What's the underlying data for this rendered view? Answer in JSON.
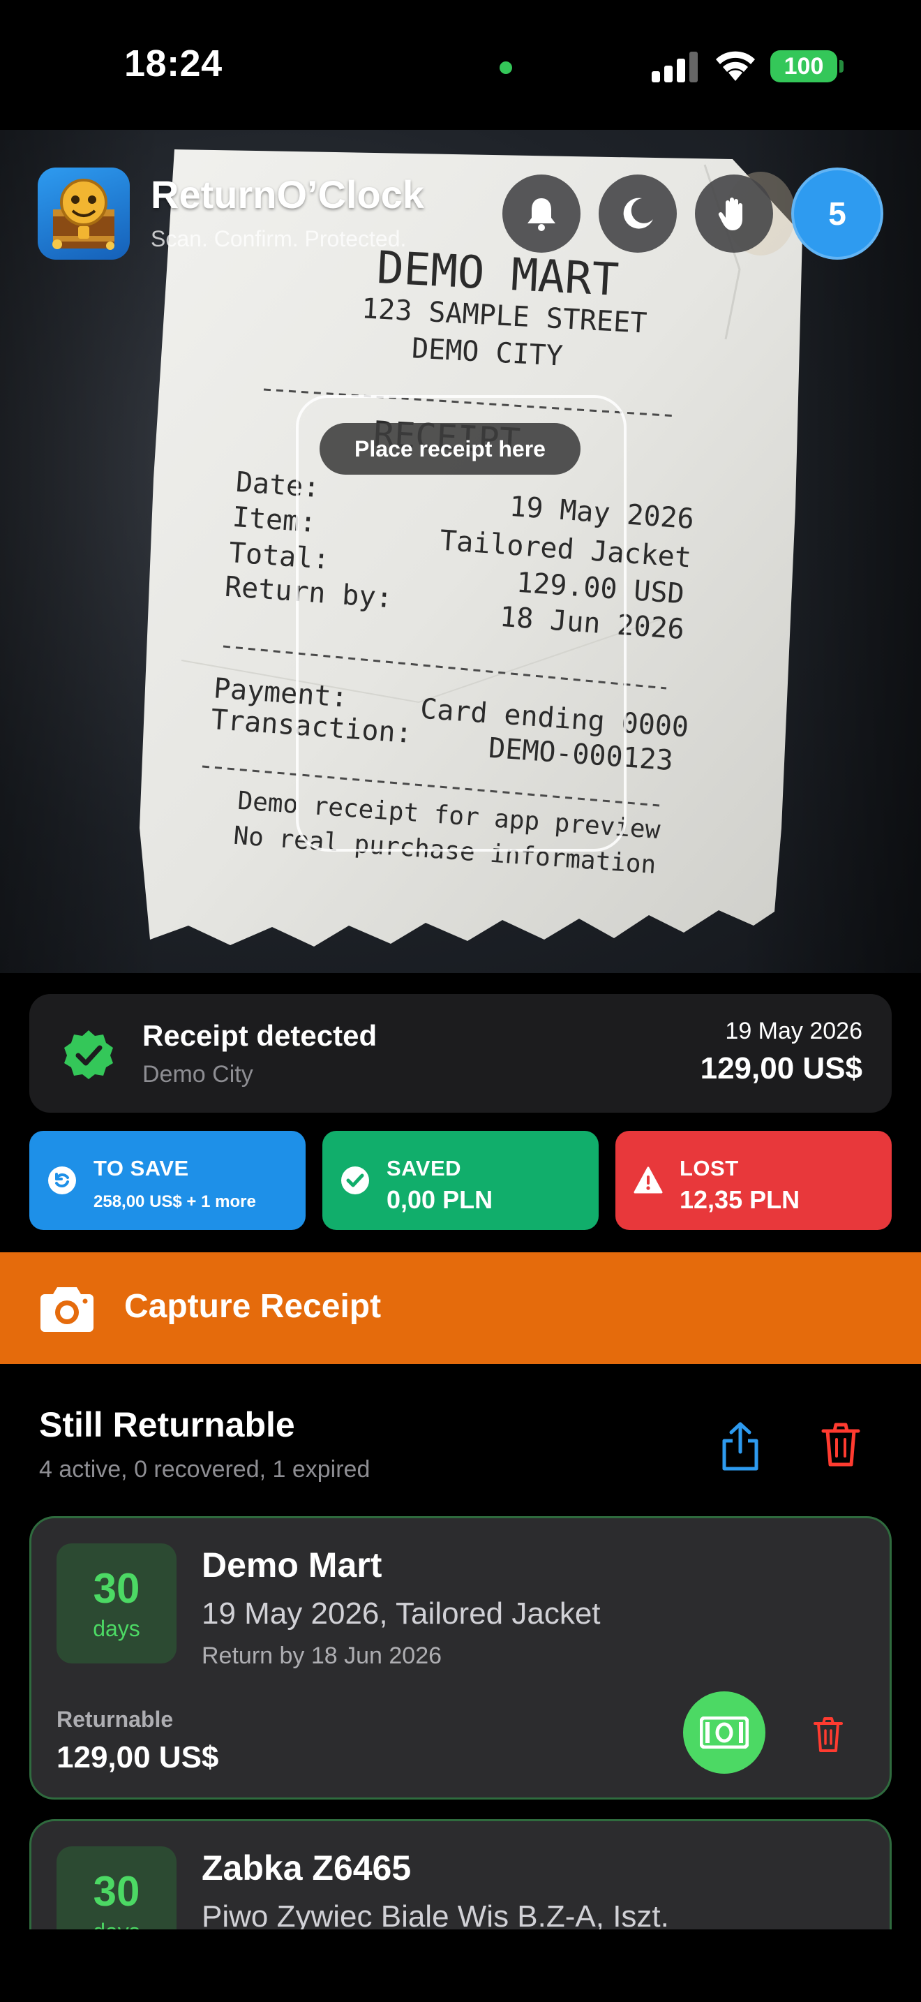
{
  "status_bar": {
    "time": "18:24",
    "battery": "100"
  },
  "camera": {
    "scan_hint": "Place receipt here",
    "receipt": {
      "store": "DEMO MART",
      "address1": "123 SAMPLE STREET",
      "address2": "DEMO CITY",
      "heading": "RECEIPT",
      "date_label": "Date:",
      "date_value": "19 May 2026",
      "item_label": "Item:",
      "item_value": "Tailored Jacket",
      "total_label": "Total:",
      "total_value": "129.00 USD",
      "return_label": "Return by:",
      "return_value": "18 Jun 2026",
      "payment_label": "Payment:",
      "payment_value": "Card ending 0000",
      "transaction_label": "Transaction:",
      "transaction_value": "DEMO-000123",
      "footer1": "Demo receipt for app preview",
      "footer2": "No real purchase information"
    }
  },
  "header": {
    "app_name": "ReturnO’Clock",
    "tagline": "Scan. Confirm. Protected.",
    "icons": [
      "bell-icon",
      "moon-icon",
      "hand-icon"
    ],
    "count": "5"
  },
  "detected": {
    "title": "Receipt detected",
    "location": "Demo City",
    "date": "19 May 2026",
    "amount": "129,00 US$"
  },
  "stats": [
    {
      "label": "TO SAVE",
      "value": "258,00 US$ + 1 more",
      "color": "#1e90e8",
      "icon": "return-icon"
    },
    {
      "label": "SAVED",
      "value": "0,00 PLN",
      "color": "#11ae6b",
      "icon": "check-icon"
    },
    {
      "label": "LOST",
      "value": "12,35 PLN",
      "color": "#e8383b",
      "icon": "warning-icon"
    }
  ],
  "capture": {
    "label": "Capture Receipt",
    "color": "#e56b0c"
  },
  "section": {
    "title": "Still Returnable",
    "summary": "4 active, 0 recovered, 1 expired"
  },
  "receipts": [
    {
      "days": "30",
      "days_label": "days",
      "store": "Demo Mart",
      "detail": "19 May 2026, Tailored Jacket",
      "return_by": "Return by 18 Jun 2026",
      "status_label": "Returnable",
      "amount": "129,00 US$"
    },
    {
      "days": "30",
      "days_label": "days",
      "store": "Zabka Z6465",
      "detail": "Piwo Zywiec Biale Wis B.Z-A, Iszt."
    }
  ]
}
